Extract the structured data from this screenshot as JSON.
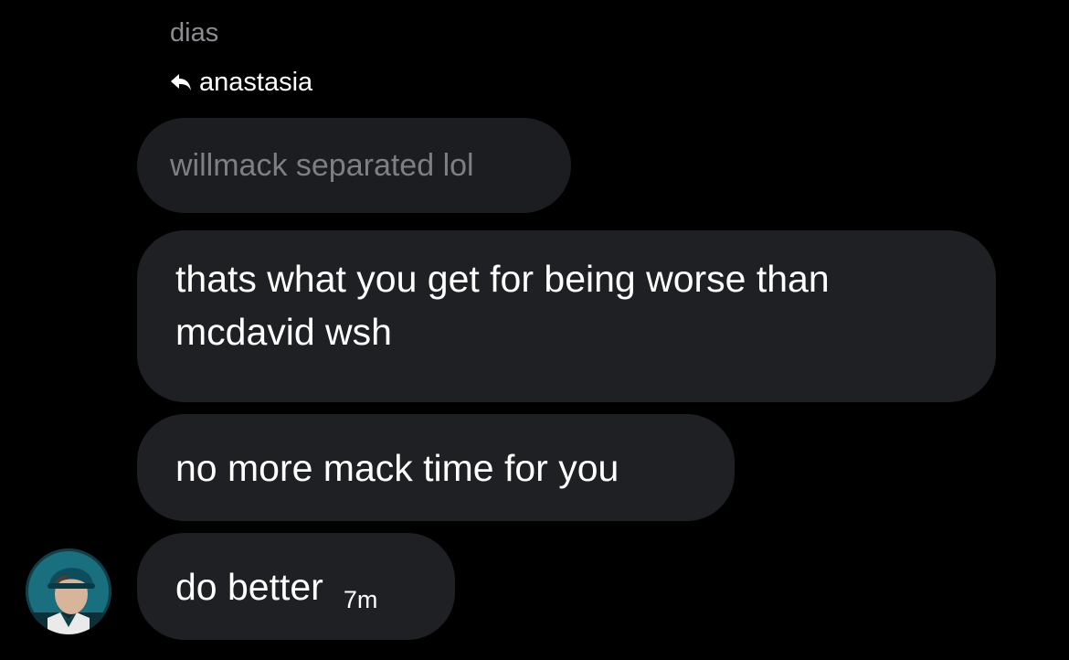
{
  "thread": {
    "sender_name": "dias",
    "reply_to_name": "anastasia",
    "quoted_message": "willmack separated lol"
  },
  "messages": [
    {
      "text": "thats what you get for being worse than mcdavid wsh"
    },
    {
      "text": "no more mack time for you"
    },
    {
      "text": "do better",
      "time": "7m"
    }
  ],
  "colors": {
    "background": "#000000",
    "bubble": "#1f2023",
    "quoted_text": "#7c7f84",
    "name_text": "#8b8d91"
  },
  "icons": {
    "reply": "reply-arrow-icon"
  }
}
